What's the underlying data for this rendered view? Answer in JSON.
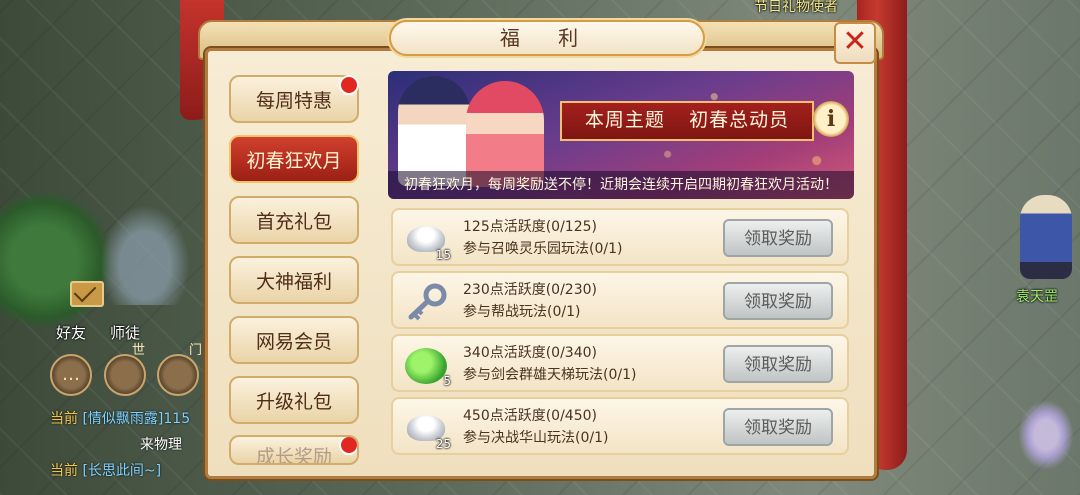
{
  "scene": {
    "npc_top": "节日礼物使者",
    "npc_right": "袁天罡",
    "hud": {
      "friends_label": "好友",
      "mentor_label": "师徒",
      "world_label": "世",
      "sect_label": "门",
      "chat": [
        {
          "channel": "当前",
          "text": "[情似飘雨露]115"
        },
        {
          "channel": "",
          "text": "来物理"
        },
        {
          "channel": "当前",
          "text": "[长思此间~]"
        }
      ]
    }
  },
  "panel": {
    "title": "福 利",
    "close_label": "✕"
  },
  "sidebar": {
    "items": [
      {
        "label": "每周特惠",
        "active": false,
        "dot": true
      },
      {
        "label": "初春狂欢月",
        "active": true,
        "dot": false
      },
      {
        "label": "首充礼包",
        "active": false,
        "dot": false
      },
      {
        "label": "大神福利",
        "active": false,
        "dot": false
      },
      {
        "label": "网易会员",
        "active": false,
        "dot": false
      },
      {
        "label": "升级礼包",
        "active": false,
        "dot": false
      },
      {
        "label": "成长奖励",
        "active": false,
        "dot": true
      }
    ]
  },
  "banner": {
    "theme_label": "本周主题",
    "theme_name": "初春总动员",
    "info_label": "i",
    "caption": "初春狂欢月，每周奖励送不停！近期会连续开启四期初春狂欢月活动！"
  },
  "rewards": [
    {
      "icon": "silver-ingot-icon",
      "count": "15",
      "points": "125点活跃度(0/125)",
      "task": "参与召唤灵乐园玩法(0/1)",
      "button": "领取奖励"
    },
    {
      "icon": "key-icon",
      "count": "",
      "points": "230点活跃度(0/230)",
      "task": "参与帮战玩法(0/1)",
      "button": "领取奖励"
    },
    {
      "icon": "gourd-icon",
      "count": "5",
      "points": "340点活跃度(0/340)",
      "task": "参与剑会群雄天梯玩法(0/1)",
      "button": "领取奖励"
    },
    {
      "icon": "silver-ingot-icon",
      "count": "25",
      "points": "450点活跃度(0/450)",
      "task": "参与决战华山玩法(0/1)",
      "button": "领取奖励"
    }
  ]
}
